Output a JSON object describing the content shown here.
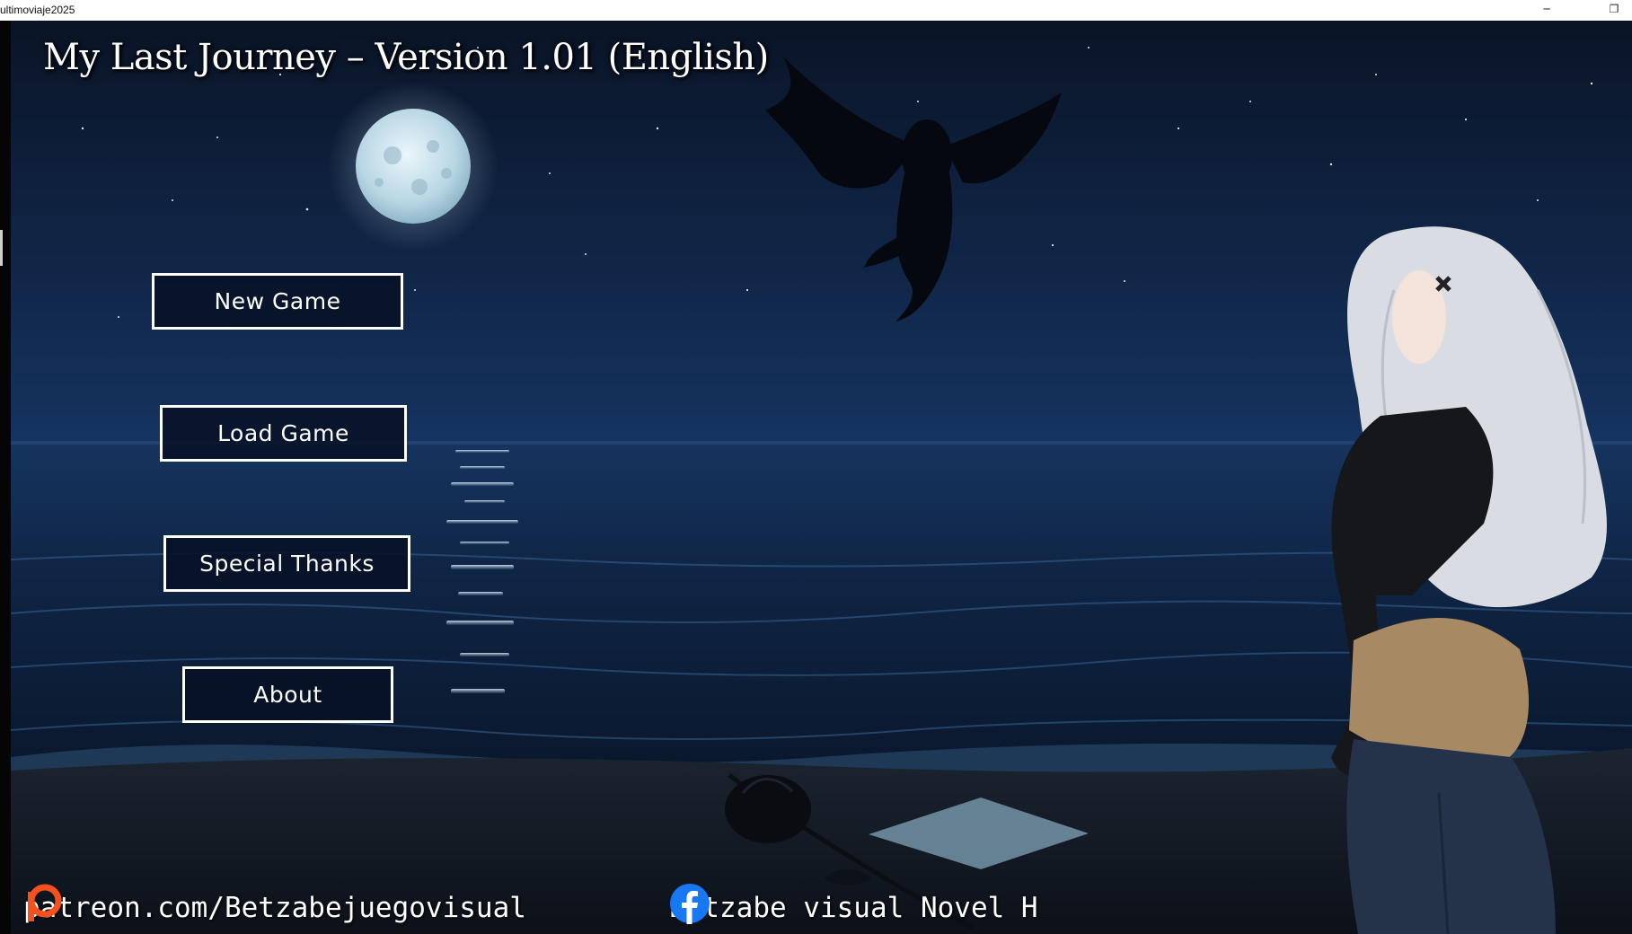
{
  "window": {
    "title": "ultimoviaje2025",
    "minimize_glyph": "─",
    "restore_glyph": "❐"
  },
  "game": {
    "title": "My Last Journey – Version 1.01 (English)"
  },
  "menu": {
    "new_game": "New Game",
    "load_game": "Load Game",
    "special_thanks": "Special Thanks",
    "about": "About"
  },
  "footer": {
    "patreon": {
      "icon": "patreon-icon",
      "text": "patreon.com/Betzabejuegovisual"
    },
    "facebook": {
      "icon": "facebook-icon",
      "text": "Betzabe visual Novel H"
    }
  },
  "colors": {
    "button_border": "#ffffff",
    "button_fill": "#071126",
    "patreon": "#f4511e",
    "facebook": "#1877f2"
  }
}
